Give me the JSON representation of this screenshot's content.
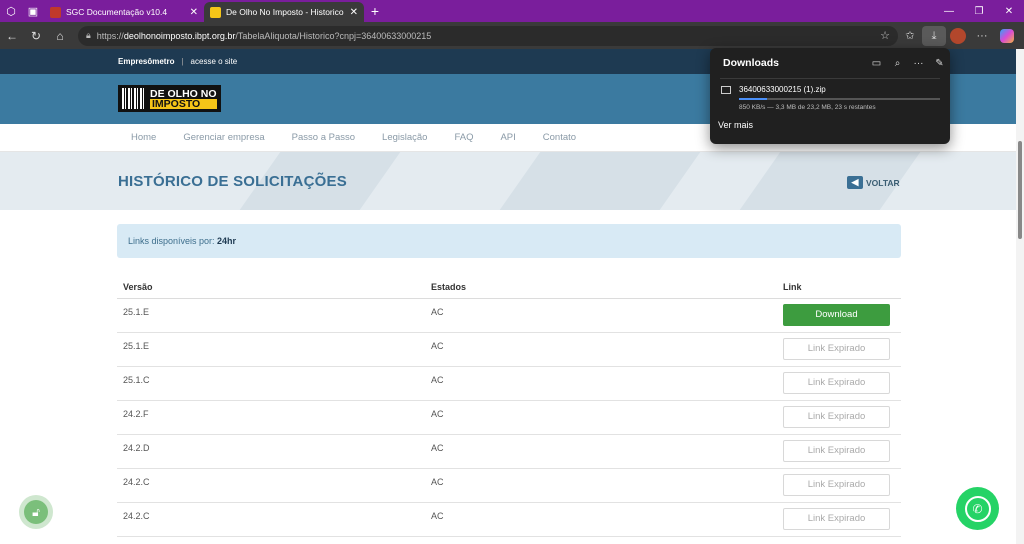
{
  "browser": {
    "tabs": [
      {
        "title": "SGC Documentação v10.4",
        "active": false
      },
      {
        "title": "De Olho No Imposto - Historico",
        "active": true
      }
    ],
    "url_prefix": "https://",
    "url_host": "deolhonoimposto.ibpt.org.br",
    "url_path": "/TabelaAliquota/Historico?cnpj=36400633000215"
  },
  "site": {
    "topstrip_brand": "Empresômetro",
    "topstrip_link": "acesse o site",
    "logo_line1": "DE OLHO NO",
    "logo_line2": "IMPOSTO",
    "nav": [
      "Home",
      "Gerenciar empresa",
      "Passo a Passo",
      "Legislação",
      "FAQ",
      "API",
      "Contato"
    ],
    "page_title": "HISTÓRICO DE SOLICITAÇÕES",
    "back_label": "VOLTAR",
    "alert_text": "Links disponíveis por: ",
    "alert_value": "24hr"
  },
  "table": {
    "headers": [
      "Versão",
      "Estados",
      "Link"
    ],
    "rows": [
      {
        "versao": "25.1.E",
        "estado": "AC",
        "link": "Download",
        "active": true
      },
      {
        "versao": "25.1.E",
        "estado": "AC",
        "link": "Link Expirado",
        "active": false
      },
      {
        "versao": "25.1.C",
        "estado": "AC",
        "link": "Link Expirado",
        "active": false
      },
      {
        "versao": "24.2.F",
        "estado": "AC",
        "link": "Link Expirado",
        "active": false
      },
      {
        "versao": "24.2.D",
        "estado": "AC",
        "link": "Link Expirado",
        "active": false
      },
      {
        "versao": "24.2.C",
        "estado": "AC",
        "link": "Link Expirado",
        "active": false
      },
      {
        "versao": "24.2.C",
        "estado": "AC",
        "link": "Link Expirado",
        "active": false
      }
    ]
  },
  "downloads": {
    "title": "Downloads",
    "filename": "36400633000215 (1).zip",
    "status": "850 KB/s — 3,3 MB de 23,2 MB, 23 s restantes",
    "progress": 0.14,
    "more_label": "Ver mais"
  },
  "colors": {
    "accent": "#3b7aa0",
    "download_button": "#3d9c3f",
    "tabbar": "#7a1e9c"
  }
}
